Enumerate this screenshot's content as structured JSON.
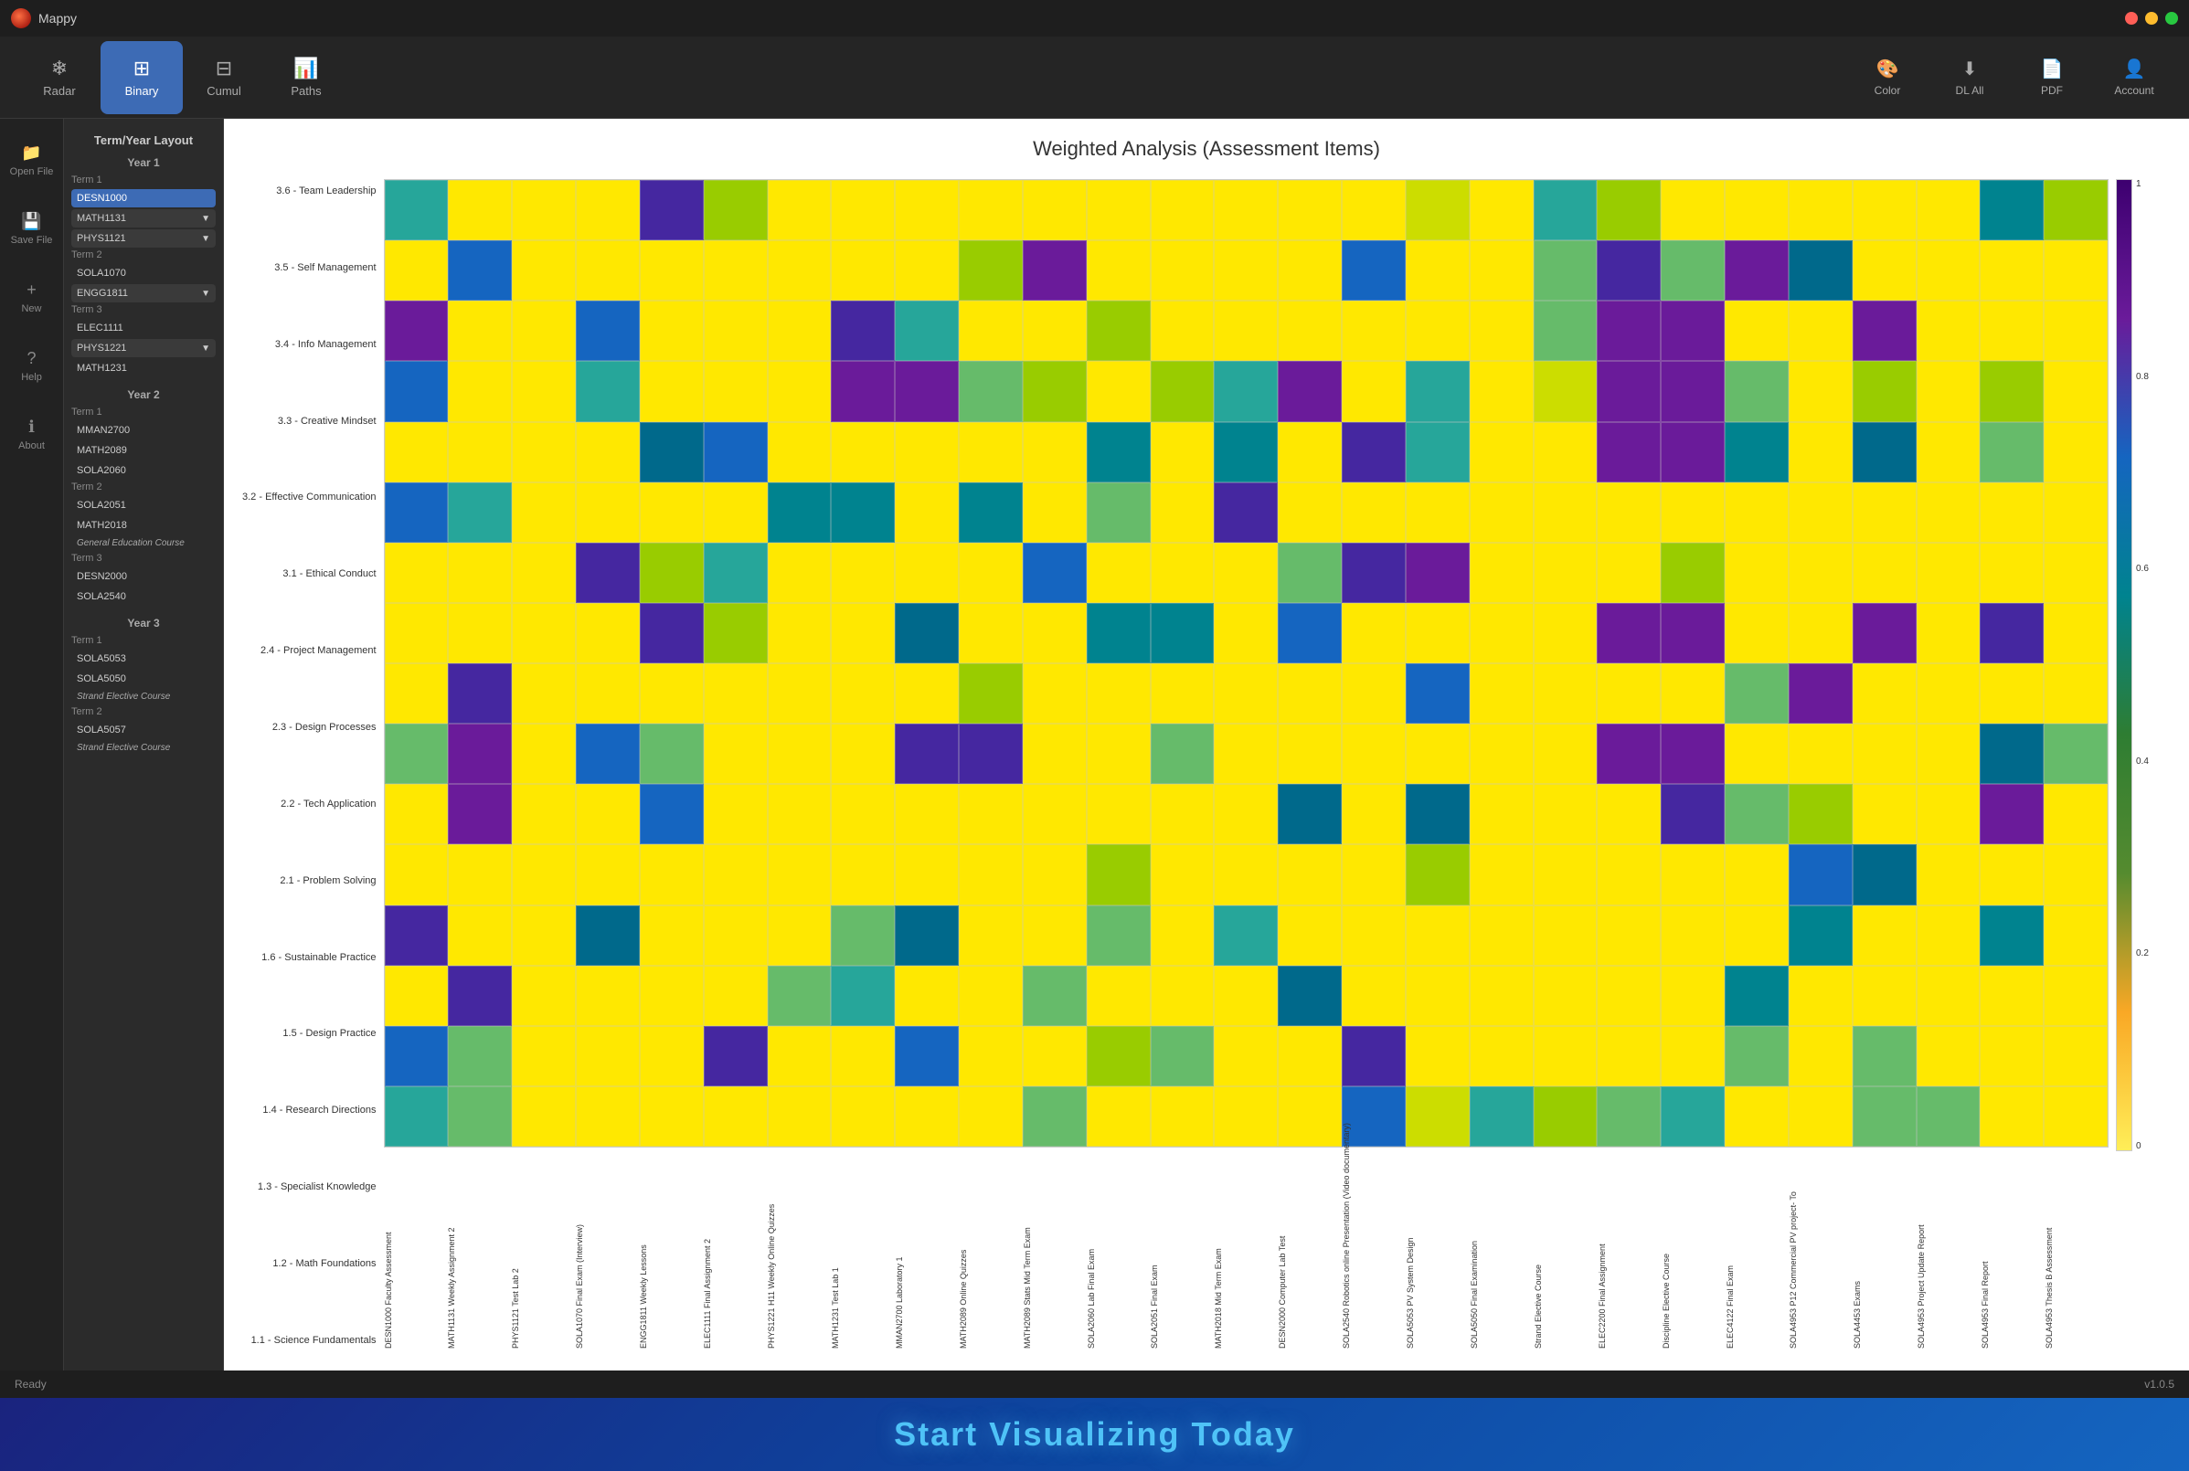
{
  "app": {
    "title": "Mappy",
    "version": "v1.0.5"
  },
  "titlebar": {
    "title": "Mappy"
  },
  "toolbar": {
    "buttons": [
      {
        "id": "radar",
        "label": "Radar",
        "icon": "❄"
      },
      {
        "id": "binary",
        "label": "Binary",
        "icon": "⊞",
        "active": true
      },
      {
        "id": "cumul",
        "label": "Cumul",
        "icon": "⊟"
      },
      {
        "id": "paths",
        "label": "Paths",
        "icon": "📊"
      }
    ],
    "right_buttons": [
      {
        "id": "color",
        "label": "Color",
        "icon": "🎨"
      },
      {
        "id": "dl_all",
        "label": "DL All",
        "icon": "⬇"
      },
      {
        "id": "pdf",
        "label": "PDF",
        "icon": "📄"
      },
      {
        "id": "account",
        "label": "Account",
        "icon": "👤"
      }
    ]
  },
  "sidebar": {
    "title": "Term/Year Layout",
    "nav_items": [
      {
        "id": "open_file",
        "label": "Open File",
        "icon": "📁"
      },
      {
        "id": "save_file",
        "label": "Save File",
        "icon": "💾"
      },
      {
        "id": "new",
        "label": "New",
        "icon": "+"
      },
      {
        "id": "help",
        "label": "Help",
        "icon": "?"
      },
      {
        "id": "about",
        "label": "About",
        "icon": "ℹ"
      }
    ],
    "years": [
      {
        "label": "Year 1",
        "terms": [
          {
            "label": "Term 1",
            "courses": [
              {
                "code": "DESN1000",
                "selected": true
              },
              {
                "code": "MATH1131",
                "expanded": true
              },
              {
                "code": "PHYS1121",
                "expanded": true
              }
            ]
          },
          {
            "label": "Term 2",
            "courses": [
              {
                "code": "SOLA1070"
              },
              {
                "code": "ENGG1811",
                "expanded": true
              }
            ]
          },
          {
            "label": "Term 3",
            "courses": [
              {
                "code": "ELEC1111"
              },
              {
                "code": "PHYS1221",
                "expanded": true
              },
              {
                "code": "MATH1231"
              }
            ]
          }
        ]
      },
      {
        "label": "Year 2",
        "terms": [
          {
            "label": "Term 1",
            "courses": [
              {
                "code": "MMAN2700"
              },
              {
                "code": "MATH2089"
              },
              {
                "code": "SOLA2060"
              }
            ]
          },
          {
            "label": "Term 2",
            "courses": [
              {
                "code": "SOLA2051"
              },
              {
                "code": "MATH2018"
              },
              {
                "tag": "General Education Course"
              }
            ]
          },
          {
            "label": "Term 3",
            "courses": [
              {
                "code": "DESN2000"
              },
              {
                "code": "SOLA2540"
              }
            ]
          }
        ]
      },
      {
        "label": "Year 3",
        "terms": [
          {
            "label": "Term 1",
            "courses": [
              {
                "code": "SOLA5053"
              },
              {
                "code": "SOLA5050"
              },
              {
                "tag": "Strand Elective Course"
              }
            ]
          },
          {
            "label": "Term 2",
            "courses": [
              {
                "code": "SOLA5057"
              },
              {
                "tag": "Strand Elective Course"
              }
            ]
          }
        ]
      }
    ]
  },
  "visualization": {
    "title": "Weighted Analysis (Assessment Items)",
    "y_labels": [
      "3.6 - Team Leadership",
      "3.5 - Self Management",
      "3.4 - Info Management",
      "3.3 - Creative Mindset",
      "3.2 - Effective Communication",
      "3.1 - Ethical Conduct",
      "2.4 - Project Management",
      "2.3 - Design Processes",
      "2.2 - Tech Application",
      "2.1 - Problem Solving",
      "1.6 - Sustainable Practice",
      "1.5 - Design Practice",
      "1.4 - Research Directions",
      "1.3 - Specialist Knowledge",
      "1.2 - Math Foundations",
      "1.1 - Science Fundamentals"
    ],
    "x_labels": [
      "DESN1000 Faculty Assessment",
      "MATH1131 Weekly Assignment 2",
      "PHYS1121 Test Lab 2",
      "SOLA1070 Final Exam (Interview)",
      "ENGG1811 Weekly Lessons",
      "ELEC1111 Final Assignment 2",
      "PHYS1221 H11 Weekly Online Quizzes",
      "MATH1231 Test Lab 1",
      "MMAN2700 Laboratory 1",
      "MATH2089 Online Quizzes",
      "MATH2089 Stats Mid Term Exam",
      "SOLA2060 Lab Final Exam",
      "SOLA2051 Final Exam",
      "MATH2018 Mid Term Exam",
      "DESN2000 Computer Lab Test",
      "SOLA2540 Robotics online Presentation (Video documentary)",
      "SOLA5053 PV System Design",
      "SOLA5050 Final Examination",
      "Strand Elective Course",
      "ELEC2200 Final Assignment",
      "Discipline Elective Course",
      "ELEC4122 Final Exam",
      "SOLA4953 P12 Commercial PV project- To",
      "SOLA4453 Exams",
      "SOLA4953 Project Update Report",
      "SOLA4953 Final Report",
      "SOLA4953 Thesis B Assessment"
    ],
    "legend": {
      "max": "1",
      "values": [
        "1",
        "0.8",
        "0.6",
        "0.4",
        "0.2",
        "0"
      ],
      "min": "0"
    }
  },
  "status": {
    "text": "Ready",
    "version": "v1.0.5"
  },
  "banner": {
    "text": "Start Visualizing Today"
  }
}
